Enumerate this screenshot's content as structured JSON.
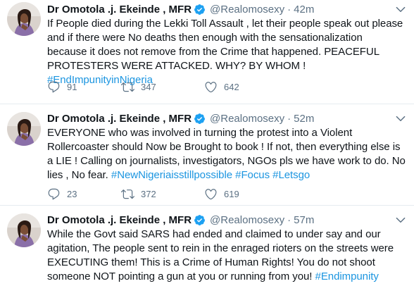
{
  "tweets": [
    {
      "name": "Dr Omotola .j. Ekeinde , MFR",
      "handle": "@Realomosexy",
      "dot": "·",
      "time": "42m",
      "lines": [
        "If People died during the Lekki Toll Assault , let their people speak out please",
        "and if there were No deaths then enough with the sensationalization",
        "because it does not remove from the Crime that happened. PEACEFUL"
      ],
      "last_line_text": "PROTESTERS WERE ATTACKED. WHY? BY WHOM ! ",
      "hashtags": [
        "#EndImpunityinNigeria"
      ],
      "replies": "91",
      "retweets": "347",
      "likes": "642"
    },
    {
      "name": "Dr Omotola .j. Ekeinde , MFR",
      "handle": "@Realomosexy",
      "dot": "·",
      "time": "52m",
      "lines": [
        "EVERYONE who was involved in turning the protest into a Violent",
        "Rollercoaster should Now be Brought to book ! If not, then everything else is",
        "a LIE !  Calling on journalists, investigators, NGOs pls we have work to do. No",
        "lies , No fear. "
      ],
      "hashtags": [
        "#NewNigeriaisstillpossible",
        "#Focus",
        "#Letsgo"
      ],
      "replies": "23",
      "retweets": "372",
      "likes": "619"
    },
    {
      "name": "Dr Omotola .j. Ekeinde , MFR",
      "handle": "@Realomosexy",
      "dot": "·",
      "time": "57m",
      "lines": [
        "While the Govt said SARS had ended and claimed to under say and our",
        "agitation, The people sent to rein in the enraged rioters on the streets were",
        "EXECUTING them! This is a Crime of Human Rights! You do not shoot",
        "someone NOT pointing a gun at you or running from you! "
      ],
      "hashtags": [
        "#Endimpunity"
      ]
    }
  ],
  "colors": {
    "accent": "#1b95e0",
    "muted": "#5b7083",
    "verified": "#1da1f2"
  },
  "icons": [
    "verified-badge-icon",
    "chevron-down-icon",
    "reply-icon",
    "retweet-icon",
    "like-icon"
  ]
}
